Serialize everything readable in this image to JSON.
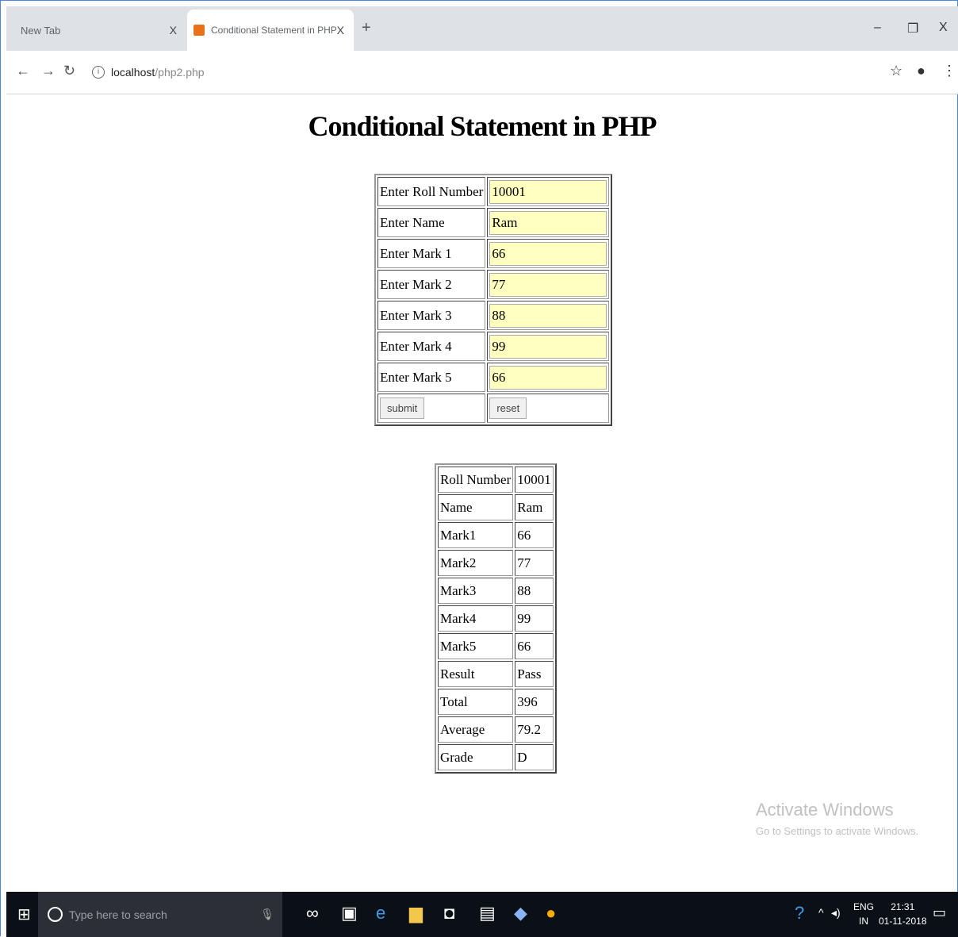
{
  "browser": {
    "tabs": [
      {
        "title": "New Tab",
        "close": "X"
      },
      {
        "title": "Conditional Statement in PHP",
        "close": "X"
      }
    ],
    "new_tab": "+",
    "window_controls": {
      "minimize": "–",
      "restore": "❐",
      "close": "X"
    },
    "address": {
      "host": "localhost",
      "path": "/php2.php"
    },
    "icons": [
      "back-icon",
      "forward-icon",
      "reload-icon",
      "info-icon",
      "star-icon",
      "profile-icon",
      "menu-icon"
    ]
  },
  "page": {
    "title": "Conditional Statement in PHP",
    "form": {
      "rows": [
        {
          "label": "Enter Roll Number",
          "value": "10001"
        },
        {
          "label": "Enter Name",
          "value": "Ram"
        },
        {
          "label": "Enter Mark 1",
          "value": "66"
        },
        {
          "label": "Enter Mark 2",
          "value": "77"
        },
        {
          "label": "Enter Mark 3",
          "value": "88"
        },
        {
          "label": "Enter Mark 4",
          "value": "99"
        },
        {
          "label": "Enter Mark 5",
          "value": "66"
        }
      ],
      "submit_label": "submit",
      "reset_label": "reset",
      "input_bg": "#ffffc0"
    },
    "result": {
      "rows": [
        {
          "label": "Roll Number",
          "value": "10001"
        },
        {
          "label": "Name",
          "value": "Ram"
        },
        {
          "label": "Mark1",
          "value": "66"
        },
        {
          "label": "Mark2",
          "value": "77"
        },
        {
          "label": "Mark3",
          "value": "88"
        },
        {
          "label": "Mark4",
          "value": "99"
        },
        {
          "label": "Mark5",
          "value": "66"
        },
        {
          "label": "Result",
          "value": "Pass"
        },
        {
          "label": "Total",
          "value": "396"
        },
        {
          "label": "Average",
          "value": "79.2"
        },
        {
          "label": "Grade",
          "value": "D"
        }
      ]
    },
    "watermark": {
      "line1": "Activate Windows",
      "line2": "Go to Settings to activate Windows."
    }
  },
  "taskbar": {
    "search_placeholder": "Type here to search",
    "tray": {
      "lang1": "ENG",
      "lang2": "IN",
      "time": "21:31",
      "date": "01-11-2018"
    },
    "icons": [
      "windows-start-icon",
      "cortana-icon",
      "microphone-icon",
      "task-view-icon",
      "store-icon",
      "edge-icon",
      "file-explorer-icon",
      "camera-icon",
      "notes-icon",
      "app-icon",
      "chrome-icon",
      "help-icon",
      "chevron-up-icon",
      "volume-icon",
      "notification-icon"
    ],
    "accent": "#0b1016"
  }
}
